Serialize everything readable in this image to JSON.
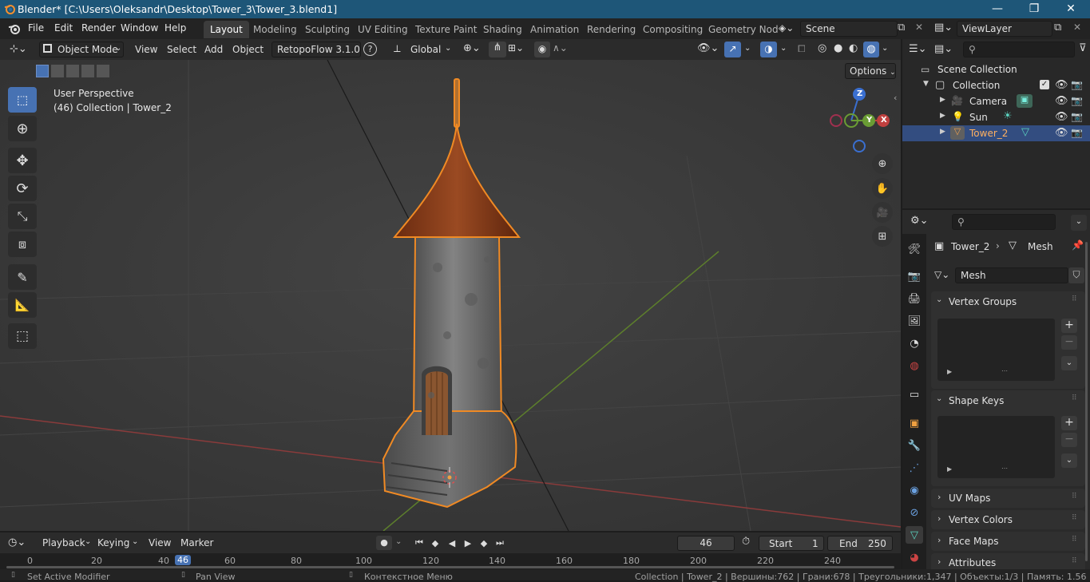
{
  "window": {
    "title": "Blender* [C:\\Users\\Oleksandr\\Desktop\\Tower_3\\Tower_3.blend1]",
    "minimize": "—",
    "maximize": "❐",
    "close": "✕"
  },
  "menu": [
    "File",
    "Edit",
    "Render",
    "Window",
    "Help"
  ],
  "workspaces": [
    "Layout",
    "Modeling",
    "Sculpting",
    "UV Editing",
    "Texture Paint",
    "Shading",
    "Animation",
    "Rendering",
    "Compositing",
    "Geometry Nod"
  ],
  "active_workspace": "Layout",
  "scene": {
    "label": "Scene"
  },
  "view_layer": {
    "label": "ViewLayer"
  },
  "viewport_header": {
    "mode": "Object Mode",
    "menus": [
      "View",
      "Select",
      "Add",
      "Object"
    ],
    "addon": "RetopoFlow 3.1.0",
    "help": "?",
    "orientation": "Global",
    "options": "Options"
  },
  "viewport": {
    "perspective": "User Perspective",
    "collection_info": "(46) Collection | Tower_2",
    "gizmo": {
      "z": "Z",
      "y": "Y",
      "x": "X"
    },
    "colors": {
      "selection_outline": "#f08a24",
      "x_axis": "#c0403f",
      "y_axis": "#6a9c34",
      "z_axis": "#3a6fd0"
    }
  },
  "outliner": {
    "root": "Scene Collection",
    "collection": "Collection",
    "items": [
      {
        "name": "Camera",
        "icon": "camera-icon"
      },
      {
        "name": "Sun",
        "icon": "sun-light-icon"
      },
      {
        "name": "Tower_2",
        "icon": "mesh-object-icon",
        "selected": true
      }
    ]
  },
  "properties": {
    "breadcrumb_object": "Tower_2",
    "breadcrumb_data": "Mesh",
    "datablock": "Mesh",
    "panels": [
      "Vertex Groups",
      "Shape Keys",
      "UV Maps",
      "Vertex Colors",
      "Face Maps",
      "Attributes"
    ]
  },
  "timeline": {
    "menus": [
      "Playback",
      "Keying",
      "View",
      "Marker"
    ],
    "current_frame": "46",
    "start_label": "Start",
    "start": "1",
    "end_label": "End",
    "end": "250",
    "ruler": [
      "0",
      "20",
      "40",
      "46",
      "60",
      "80",
      "100",
      "120",
      "140",
      "160",
      "180",
      "200",
      "220",
      "240"
    ]
  },
  "status": {
    "left": "Set Active Modifier",
    "mid": "Pan View",
    "right_hint": "Контекстное Меню",
    "stats": "Collection | Tower_2 | Вершины:762 | Грани:678 | Треугольники:1,347 | Объекты:1/3 | Память: 1.56 GiB | 3.0.0"
  }
}
